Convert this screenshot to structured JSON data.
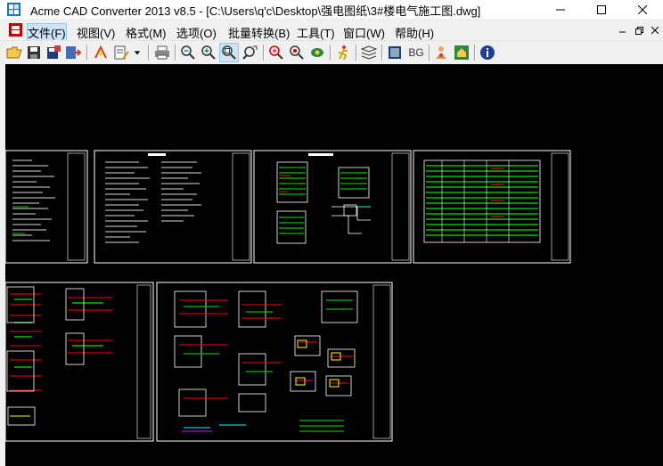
{
  "window": {
    "title": "Acme CAD Converter 2013 v8.5 - [C:\\Users\\q'c\\Desktop\\强电图纸\\3#楼电气施工图.dwg]"
  },
  "menu": [
    {
      "label": "文件(F)"
    },
    {
      "label": "视图(V)"
    },
    {
      "label": "格式(M)"
    },
    {
      "label": "选项(O)"
    },
    {
      "label": "批量转换(B)"
    },
    {
      "label": "工具(T)"
    },
    {
      "label": "窗口(W)"
    },
    {
      "label": "帮助(H)"
    }
  ],
  "toolbar": {
    "bg_label": "BG",
    "icons": [
      "open-icon",
      "save-icon",
      "save-as-icon",
      "export-icon",
      "layers-icon",
      "pen-settings-icon",
      "dropdown-icon",
      "print-icon",
      "zoom-out-icon",
      "zoom-in-icon",
      "zoom-window-icon",
      "zoom-realtime-icon",
      "zoom-extents-icon",
      "pan-icon",
      "view-3d-icon",
      "eye-icon",
      "run-icon",
      "layer-manager-icon",
      "sheet-icon",
      "background-color-icon",
      "users-icon",
      "home-icon",
      "about-icon"
    ]
  },
  "colors": {
    "canvas_background": "#000000",
    "drawing_line": "#ffffff",
    "drawing_green": "#00c000",
    "drawing_red": "#ff0000",
    "drawing_yellow": "#ffff00",
    "drawing_cyan": "#00ffff"
  }
}
